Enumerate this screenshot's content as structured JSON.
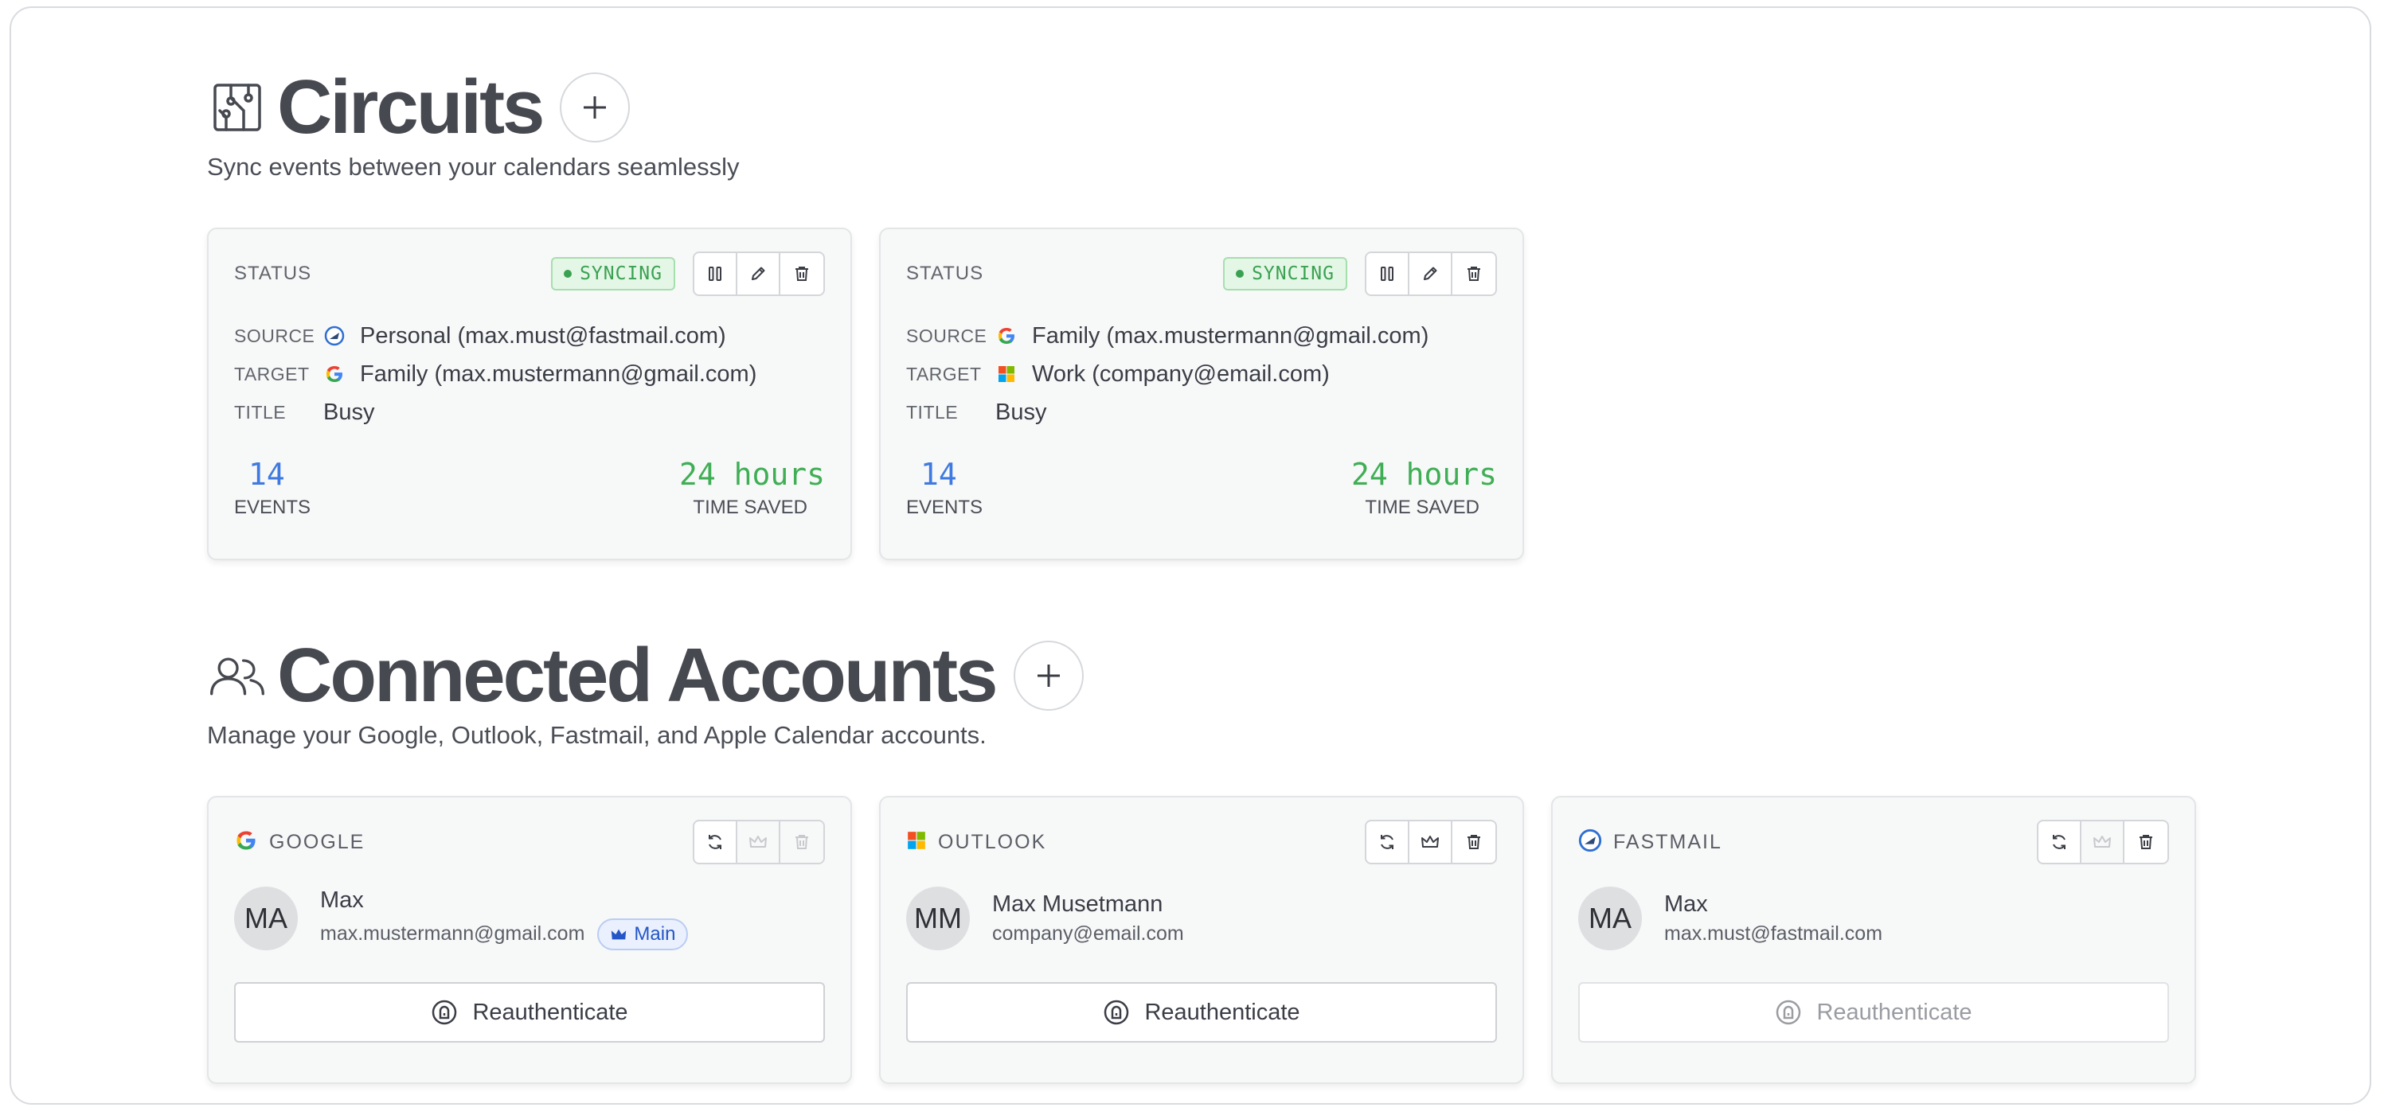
{
  "circuits": {
    "title": "Circuits",
    "subtitle": "Sync events between your calendars seamlessly",
    "items": [
      {
        "status_label": "STATUS",
        "status": "SYNCING",
        "source_label": "SOURCE",
        "source_provider": "fastmail",
        "source": "Personal (max.must@fastmail.com)",
        "target_label": "TARGET",
        "target_provider": "google",
        "target": "Family (max.mustermann@gmail.com)",
        "title_label": "TITLE",
        "title_value": "Busy",
        "events": "14",
        "events_label": "EVENTS",
        "time_saved": "24 hours",
        "time_saved_label": "TIME SAVED"
      },
      {
        "status_label": "STATUS",
        "status": "SYNCING",
        "source_label": "SOURCE",
        "source_provider": "google",
        "source": "Family (max.mustermann@gmail.com)",
        "target_label": "TARGET",
        "target_provider": "outlook",
        "target": "Work (company@email.com)",
        "title_label": "TITLE",
        "title_value": "Busy",
        "events": "14",
        "events_label": "EVENTS",
        "time_saved": "24 hours",
        "time_saved_label": "TIME SAVED"
      }
    ]
  },
  "accounts": {
    "title": "Connected Accounts",
    "subtitle": "Manage your Google, Outlook, Fastmail, and Apple Calendar accounts.",
    "reauth_label": "Reauthenticate",
    "items": [
      {
        "provider": "GOOGLE",
        "initials": "MA",
        "name": "Max",
        "email": "max.mustermann@gmail.com",
        "main_badge": "Main"
      },
      {
        "provider": "OUTLOOK",
        "initials": "MM",
        "name": "Max Musetmann",
        "email": "company@email.com"
      },
      {
        "provider": "FASTMAIL",
        "initials": "MA",
        "name": "Max",
        "email": "max.must@fastmail.com"
      }
    ]
  },
  "colors": {
    "syncing_green": "#3aa152",
    "events_blue": "#3f7ae0",
    "time_green": "#3fae55",
    "main_badge_blue": "#2456c7"
  }
}
